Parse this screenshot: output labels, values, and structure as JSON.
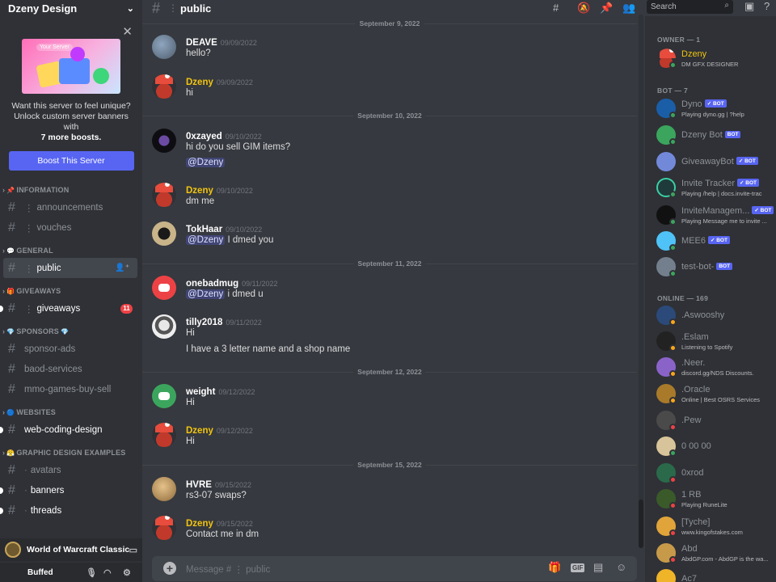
{
  "server": {
    "name": "Dzeny Design",
    "boost": {
      "art_label": "Your Server",
      "text_line1": "Want this server to feel unique?",
      "text_line2": "Unlock custom server banners with",
      "text_bold": "7 more boosts.",
      "button": "Boost This Server"
    },
    "categories": [
      {
        "emoji": "📌",
        "name": "INFORMATION"
      },
      {
        "emoji": "💬",
        "name": "GENERAL"
      },
      {
        "emoji": "🎁",
        "name": "GIVEAWAYS"
      },
      {
        "emoji": "💎",
        "name": "SPONSORS",
        "emoji2": "💎"
      },
      {
        "emoji": "🔵",
        "name": "WEBSITES"
      },
      {
        "emoji": "😤",
        "name": "GRAPHIC DESIGN EXAMPLES"
      }
    ],
    "channels": {
      "announcements": "announcements",
      "vouches": "vouches",
      "public": "public",
      "giveaways": "giveaways",
      "giveaways_badge": "11",
      "sponsor_ads": "sponsor-ads",
      "baod_services": "baod-services",
      "mmo": "mmo-games-buy-sell",
      "web_coding": "web-coding-design",
      "avatars": "avatars",
      "banners": "banners",
      "threads": "threads"
    },
    "voice_activity": "World of Warcraft Classic",
    "user": "Buffed"
  },
  "channel_header": {
    "name": "public",
    "search_placeholder": "Search"
  },
  "messages": {
    "dates": [
      "September 9, 2022",
      "September 10, 2022",
      "September 11, 2022",
      "September 12, 2022",
      "September 15, 2022"
    ],
    "items": [
      {
        "author": "DEAVE",
        "ts": "09/09/2022",
        "text": "hello?"
      },
      {
        "author": "Dzeny",
        "ts": "09/09/2022",
        "text": "hi"
      },
      {
        "author": "0xzayed",
        "ts": "09/10/2022",
        "text": "hi do you sell GIM items?",
        "mention": "@Dzeny"
      },
      {
        "author": "Dzeny",
        "ts": "09/10/2022",
        "text": "dm me"
      },
      {
        "author": "TokHaar",
        "ts": "09/10/2022",
        "mention": "@Dzeny",
        "text": " I dmed you"
      },
      {
        "author": "onebadmug",
        "ts": "09/11/2022",
        "mention": "@Dzeny",
        "text": " i dmed u"
      },
      {
        "author": "tilly2018",
        "ts": "09/11/2022",
        "text": "Hi",
        "text2": "I have a 3 letter name and a shop name"
      },
      {
        "author": "weight",
        "ts": "09/12/2022",
        "text": "Hi"
      },
      {
        "author": "Dzeny",
        "ts": "09/12/2022",
        "text": "Hi"
      },
      {
        "author": "HVRE",
        "ts": "09/15/2022",
        "text": "rs3-07 swaps?"
      },
      {
        "author": "Dzeny",
        "ts": "09/15/2022",
        "text": "Contact me in dm"
      }
    ]
  },
  "composer": {
    "placeholder": "Message #  ⋮ public",
    "gif": "GIF"
  },
  "members": {
    "owner_header": "OWNER — 1",
    "bot_header": "BOT — 7",
    "online_header": "ONLINE — 169",
    "owner": {
      "name": "Dzeny",
      "sub": "DM GFX DESIGNER"
    },
    "bots": [
      {
        "name": "Dyno",
        "tag": "✓ BOT",
        "sub": "Playing dyno.gg | ?help"
      },
      {
        "name": "Dzeny Bot",
        "tag": "BOT"
      },
      {
        "name": "GiveawayBot",
        "tag": "✓ BOT"
      },
      {
        "name": "Invite Tracker",
        "tag": "✓ BOT",
        "sub": "Playing /help | docs.invite-trac"
      },
      {
        "name": "InviteManagem...",
        "tag": "✓ BOT",
        "sub": "Playing Message me to invite ..."
      },
      {
        "name": "MEE6",
        "tag": "✓ BOT"
      },
      {
        "name": "test-bot-",
        "tag": "BOT"
      }
    ],
    "online": [
      {
        "name": ".Aswooshy"
      },
      {
        "name": ".Eslam",
        "sub": "Listening to Spotify"
      },
      {
        "name": ".Neer.",
        "sub": "discord.gg/NDS Discounts."
      },
      {
        "name": ".Oracle",
        "sub": "Online | Best OSRS Services"
      },
      {
        "name": ".Pew"
      },
      {
        "name": "0 00 00"
      },
      {
        "name": "0xrod"
      },
      {
        "name": "1 RB",
        "sub": "Playing RuneLite"
      },
      {
        "name": "[Tyche]",
        "sub": "www.kingofstakes.com"
      },
      {
        "name": "Abd",
        "sub": "AbdGP.com - AbdGP is the wa..."
      },
      {
        "name": "Ac7"
      }
    ]
  },
  "colors": {
    "accent": "#5865f2",
    "owner": "#f1c40f",
    "online": "#3ba55d",
    "idle": "#faa61a",
    "dnd": "#ed4245"
  }
}
